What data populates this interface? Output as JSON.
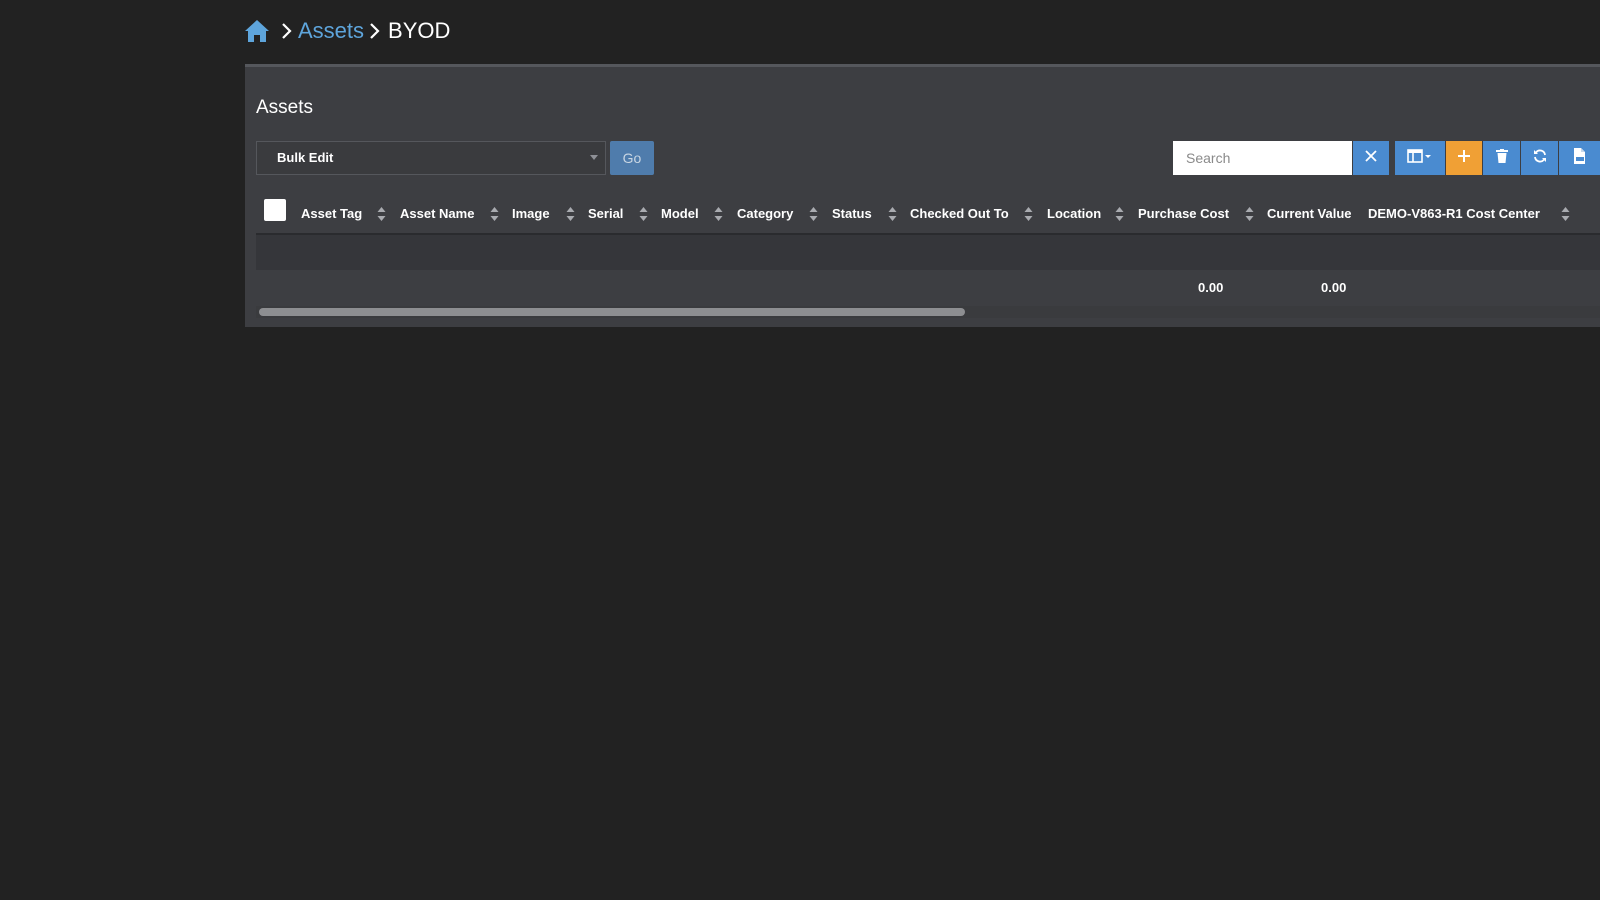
{
  "breadcrumb": {
    "home_icon": "home-icon",
    "items": [
      {
        "label": "Assets",
        "link": true
      },
      {
        "label": "BYOD",
        "link": false
      }
    ]
  },
  "panel": {
    "title": "Assets"
  },
  "toolbar": {
    "bulk_select_value": "Bulk Edit",
    "go_label": "Go",
    "search_placeholder": "Search",
    "buttons": [
      {
        "name": "clear-search",
        "icon": "close-icon",
        "color": "#4a8bd0"
      },
      {
        "name": "columns",
        "icon": "columns-icon",
        "color": "#4a8bd0"
      },
      {
        "name": "add",
        "icon": "plus-icon",
        "color": "#f0a035"
      },
      {
        "name": "delete",
        "icon": "trash-icon",
        "color": "#4a8bd0"
      },
      {
        "name": "refresh",
        "icon": "refresh-icon",
        "color": "#4a8bd0"
      },
      {
        "name": "export",
        "icon": "export-csv-icon",
        "color": "#4a8bd0"
      }
    ]
  },
  "table": {
    "columns": [
      "Asset Tag",
      "Asset Name",
      "Image",
      "Serial",
      "Model",
      "Category",
      "Status",
      "Checked Out To",
      "Location",
      "Purchase Cost",
      "Current Value",
      "DEMO-V863-R1 Cost Center"
    ],
    "rows": [],
    "footer": {
      "purchase_cost_total": "0.00",
      "current_value_total": "0.00"
    }
  },
  "colors": {
    "background": "#222222",
    "panel": "#3d3e42",
    "link": "#5ea5dc",
    "primary_button": "#4a8bd0",
    "add_button": "#f0a035",
    "go_button": "#4f7cac"
  }
}
